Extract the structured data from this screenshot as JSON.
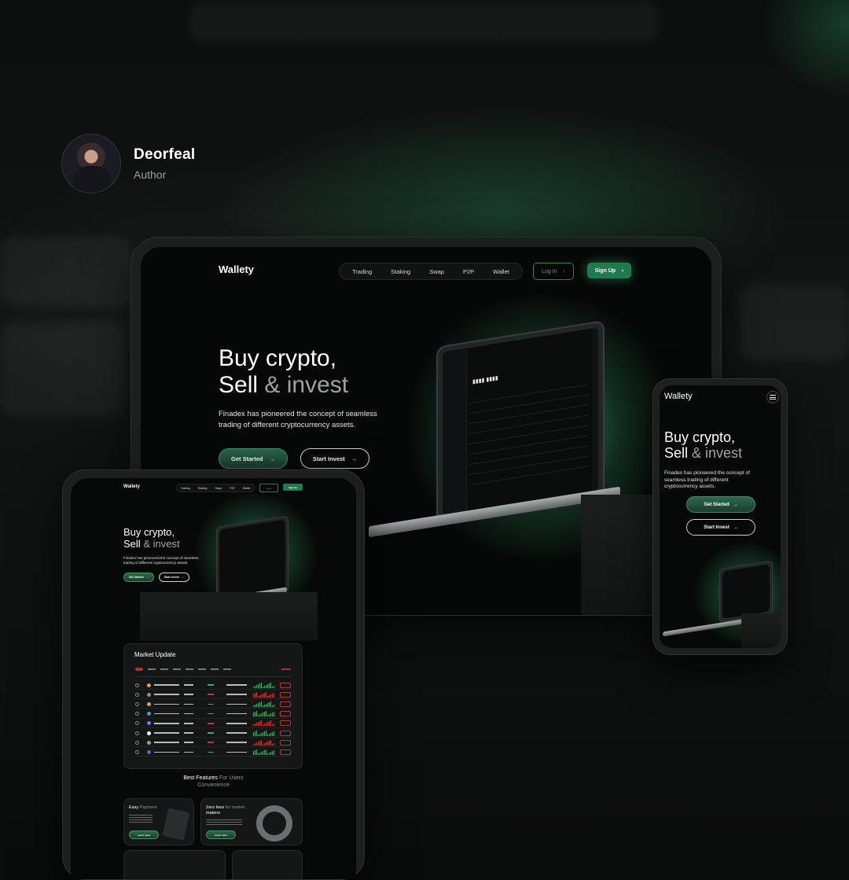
{
  "author": {
    "name": "Deorfeal",
    "role": "Author"
  },
  "site": {
    "logo": "Wallety",
    "nav": [
      "Trading",
      "Staking",
      "Swap",
      "P2P",
      "Wallet"
    ],
    "login": "Log In",
    "signup": "Sign Up",
    "hero_line1": "Buy crypto,",
    "hero_line2a": "Sell",
    "hero_line2b": "& invest",
    "hero_sub_line1": "Finadex has pioneered the concept of seamless",
    "hero_sub_line2": "trading of different cryptocurrency assets.",
    "get_started": "Get Started",
    "start_invest": "Start Invest"
  },
  "phone": {
    "sub_line1": "Finadex has pioneered the concept of",
    "sub_line2": "seamless trading of different",
    "sub_line3": "cryptocurrency assets."
  },
  "tablet": {
    "sub_line1": "Finadex has pioneered the concept of seamless",
    "sub_line2": "trading of different cryptocurrency assets.",
    "market_title": "Market Update",
    "features_title_a": "Best Features",
    "features_title_b": "For Users",
    "features_title_c": "Convenience",
    "feature1_title_a": "Easy",
    "feature1_title_b": "Payment",
    "feature2_title_a": "Zero fees",
    "feature2_title_b": "for market",
    "feature2_title_c": "makers",
    "learn_more": "Learn more"
  },
  "colors": {
    "accent": "#1f7a4d",
    "accent_light": "#3fa874",
    "down": "#c0393b",
    "background": "#0a0b0b"
  }
}
